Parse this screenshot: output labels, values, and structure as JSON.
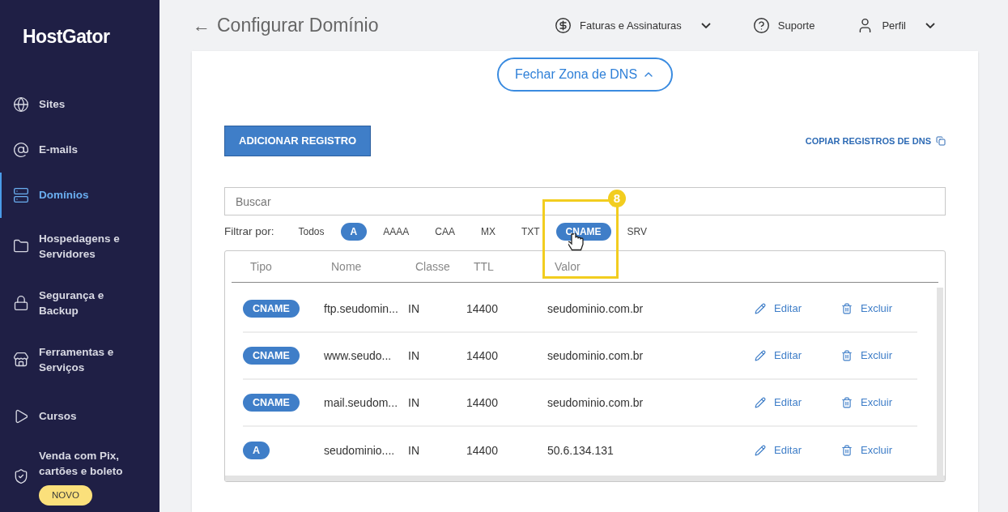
{
  "sidebar": {
    "logo": "HostGator",
    "items": [
      {
        "label": "Sites",
        "selected": false
      },
      {
        "label": "E-mails",
        "selected": false
      },
      {
        "label": "Domínios",
        "selected": true
      },
      {
        "label": "Hospedagens e Servidores",
        "selected": false
      },
      {
        "label": "Segurança e Backup",
        "selected": false
      },
      {
        "label": "Ferramentas e Serviços",
        "selected": false
      },
      {
        "label": "Cursos",
        "selected": false
      },
      {
        "label": "Venda com Pix, cartões e boleto",
        "selected": false,
        "badge": "NOVO"
      }
    ]
  },
  "header": {
    "back_arrow": "←",
    "title": "Configurar Domínio",
    "menu": [
      {
        "label": "Faturas e Assinaturas",
        "dropdown": true
      },
      {
        "label": "Suporte",
        "dropdown": false
      },
      {
        "label": "Perfil",
        "dropdown": true
      }
    ]
  },
  "toggle_button": "Fechar Zona de DNS",
  "add_button": "ADICIONAR REGISTRO",
  "copy_link": "COPIAR REGISTROS DE DNS",
  "search": {
    "placeholder": "Buscar"
  },
  "filter": {
    "label": "Filtrar por:",
    "options": [
      {
        "label": "Todos",
        "selected": false
      },
      {
        "label": "A",
        "selected": true
      },
      {
        "label": "AAAA",
        "selected": false
      },
      {
        "label": "CAA",
        "selected": false
      },
      {
        "label": "MX",
        "selected": false
      },
      {
        "label": "TXT",
        "selected": false
      },
      {
        "label": "CNAME",
        "selected": true
      },
      {
        "label": "SRV",
        "selected": false
      }
    ]
  },
  "annotation": {
    "step": "8"
  },
  "table": {
    "columns": [
      "Tipo",
      "Nome",
      "Classe",
      "TTL",
      "Valor"
    ],
    "rows": [
      {
        "type": "CNAME",
        "name": "ftp.seudomin...",
        "class": "IN",
        "ttl": "14400",
        "value": "seudominio.com.br",
        "edit": "Editar",
        "delete": "Excluir"
      },
      {
        "type": "CNAME",
        "name": "www.seudo...",
        "class": "IN",
        "ttl": "14400",
        "value": "seudominio.com.br",
        "edit": "Editar",
        "delete": "Excluir"
      },
      {
        "type": "CNAME",
        "name": "mail.seudom...",
        "class": "IN",
        "ttl": "14400",
        "value": "seudominio.com.br",
        "edit": "Editar",
        "delete": "Excluir"
      },
      {
        "type": "A",
        "name": "seudominio....",
        "class": "IN",
        "ttl": "14400",
        "value": "50.6.134.131",
        "edit": "Editar",
        "delete": "Excluir"
      }
    ]
  }
}
